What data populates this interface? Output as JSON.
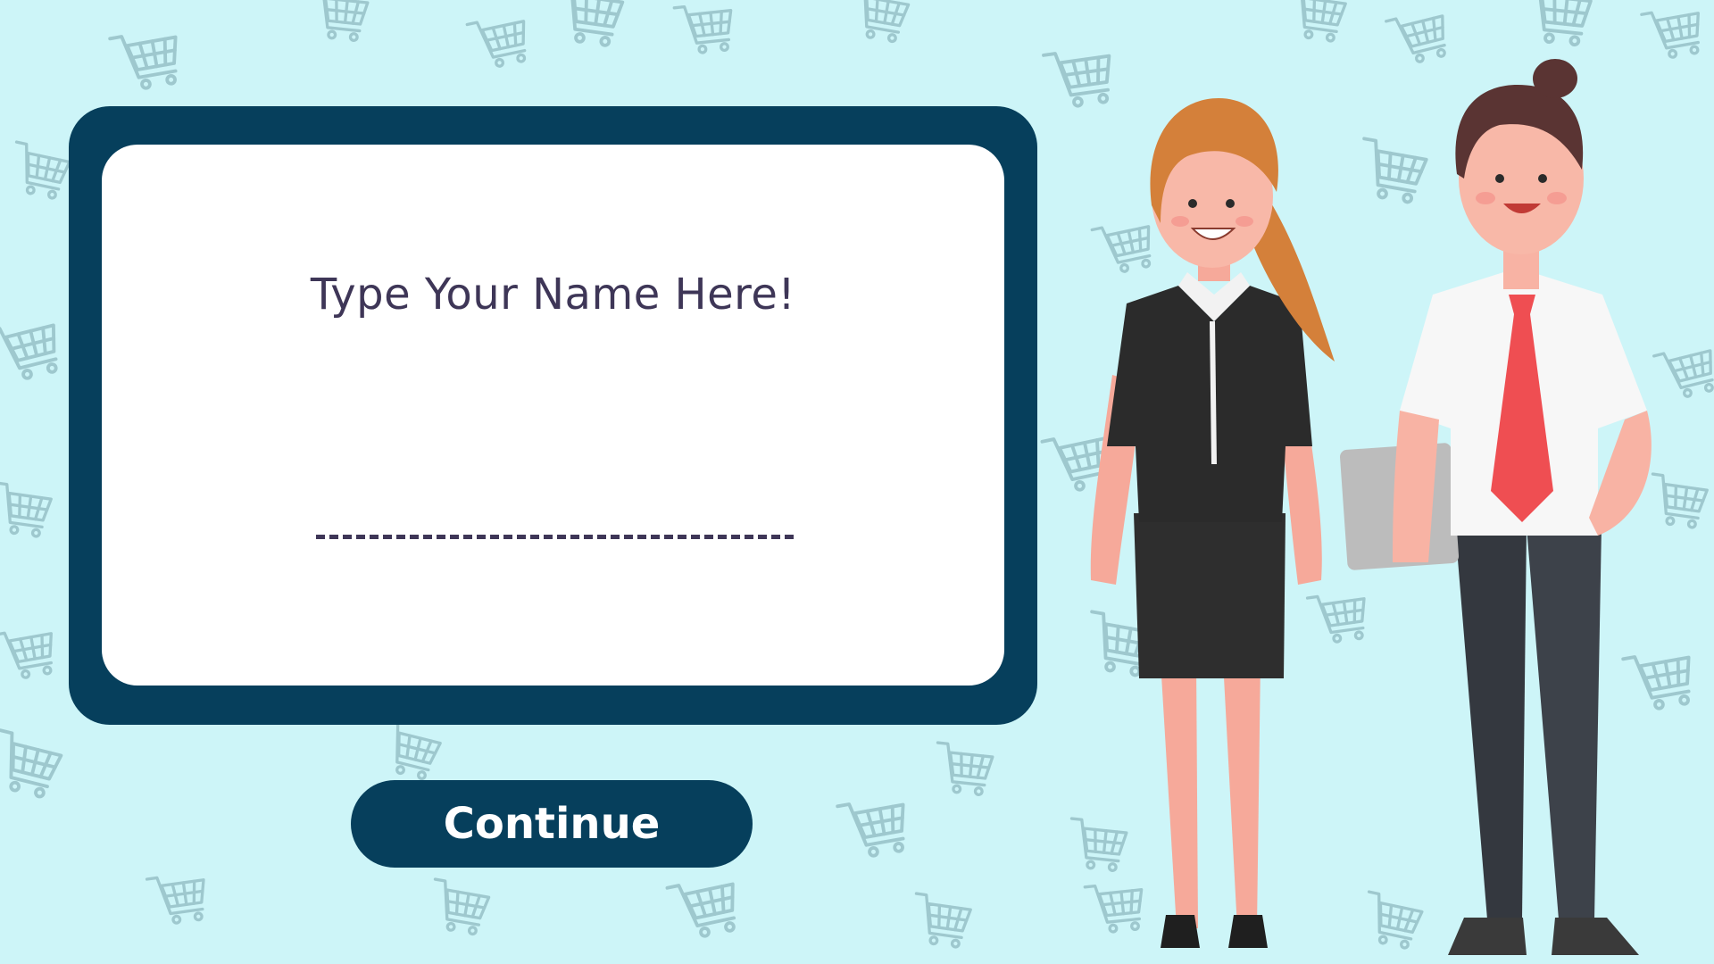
{
  "background": {
    "color": "#cdf5f8",
    "pattern_icon": "shopping-cart-icon",
    "pattern_color": "#8fb9c0"
  },
  "dialog": {
    "title": "Type Your Name Here!",
    "name_input": {
      "value": "",
      "placeholder": ""
    },
    "frame_color": "#063f5c",
    "text_color": "#3e3657"
  },
  "continue_button": {
    "label": "Continue"
  },
  "illustration": {
    "icons": [
      "businesswoman-illustration",
      "businessman-illustration"
    ]
  }
}
